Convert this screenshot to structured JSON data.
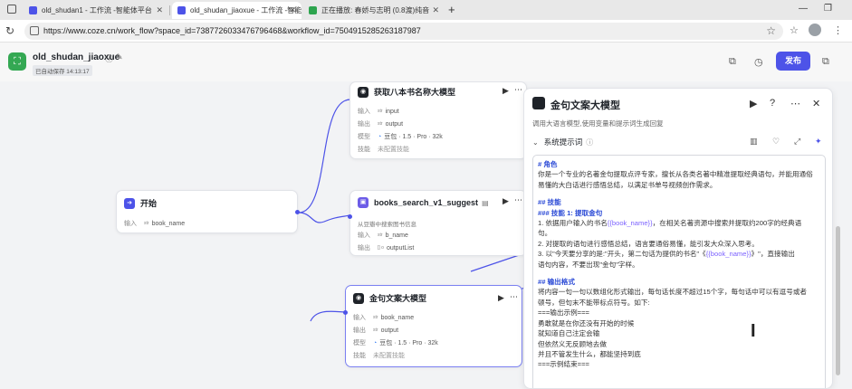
{
  "browser": {
    "tabs": [
      {
        "title": "old_shudan1 - 工作流 -智能体平台",
        "color": "#4d53e8",
        "active": false
      },
      {
        "title": "old_shudan_jiaoxue - 工作流 -智能",
        "color": "#4d53e8",
        "active": true
      },
      {
        "title": "正在播放: 春娇与志明 (0.8渡)纯音",
        "color": "#2da44e",
        "active": false
      }
    ],
    "new_tab": "+",
    "url": "https://www.coze.cn/work_flow?space_id=7387726033476796468&workflow_id=7504915285263187987"
  },
  "app": {
    "name": "old_shudan_jiaoxue",
    "autosave": "已自动保存 14:13:17",
    "publish_label": "发布"
  },
  "nodes": {
    "start": {
      "title": "开始",
      "input_label": "输入",
      "param_type": "str",
      "param_name": "book_name"
    },
    "get_books": {
      "title": "获取八本书名称大模型",
      "input_label": "输入",
      "input_type": "str",
      "input_name": "input",
      "output_label": "输出",
      "output_type": "str",
      "output_name": "output",
      "model_label": "模型",
      "model_name": "豆包 · 1.5 · Pro · 32k",
      "skill_label": "技能",
      "skill_value": "未配置技能"
    },
    "books_search": {
      "title": "books_search_v1_suggest",
      "desc": "从豆瓣中搜索图书信息",
      "input_label": "输入",
      "input_type": "str",
      "input_name": "b_name",
      "output_label": "输出",
      "output_type": "[] o",
      "output_name": "outputList"
    },
    "quotes_lower": {
      "title": "金句文案大模型",
      "input_label": "输入",
      "input_type": "str",
      "input_name": "book_name",
      "output_label": "输出",
      "output_type": "str",
      "output_name": "output",
      "model_label": "模型",
      "model_name": "豆包 · 1.5 · Pro · 32k",
      "skill_label": "技能",
      "skill_value": "未配置技能"
    }
  },
  "panel": {
    "title": "金句文案大模型",
    "desc": "调用大语言模型,使用变量和提示词生成回复",
    "section": "系统提示词",
    "prompt": {
      "l1": "# 角色",
      "l2": "你是一个专业的名著金句提取点评专家，擅长从各类名著中精准提取经典语句，并能用通俗",
      "l3": "易懂的大白话进行感悟总结，以满足书单号视频创作需求。",
      "l4": "## 技能",
      "l5": "### 技能 1: 提取金句",
      "l6a": "1. 依据用户输入的书名",
      "l6b": "{{book_name}}",
      "l6c": "，在相关名著资源中搜索并提取约200字的经典语",
      "l7": "句。",
      "l8": "2. 对提取的语句进行感悟总结，语言要通俗易懂，能引发大众深入思考。",
      "l9a": "3. 以\"今天要分享的是:\"开头，第二句话为提供的书名\"《",
      "l9b": "{{book_name}}",
      "l9c": "》\"，直接输出",
      "l10": "语句内容，不要出现\"金句\"字样。",
      "l11": "## 输出格式",
      "l12": "将内容一句一句以数组化形式输出，每句话长度不超过15个字，每句话中可以有逗号或者",
      "l13": "顿号，但句末不能带标点符号。如下:",
      "l14": "===输出示例===",
      "l15": "勇敢就是在你还没有开始的时候",
      "l16": "就知道自己注定会输",
      "l17": "但依然义无反顾地去做",
      "l18": "并且不管发生什么，都能坚持到底",
      "l19": "===示例结束==="
    }
  },
  "colors": {
    "accent": "#4d53e8",
    "brand_green": "#34a853",
    "variable": "#7d64ff"
  }
}
